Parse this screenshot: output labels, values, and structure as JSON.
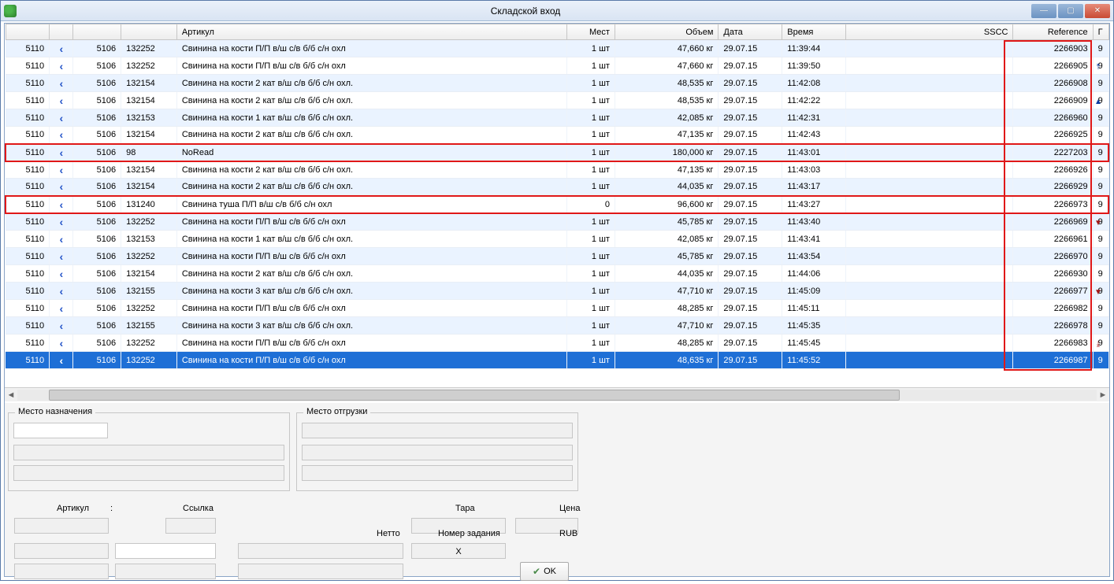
{
  "window": {
    "title": "Складской вход"
  },
  "columns": {
    "article": "Артикул",
    "mest": "Мест",
    "volume": "Объем",
    "date": "Дата",
    "time": "Время",
    "sscc": "SSCC",
    "reference": "Reference",
    "extra": "Г"
  },
  "rows": [
    {
      "c1": "5110",
      "c2": "5106",
      "c3": "132252",
      "desc": "Свинина на кости П/П в/ш с/в б/б с/н охл",
      "mest": "1 шт",
      "vol": "47,660 кг",
      "date": "29.07.15",
      "time": "11:39:44",
      "ref": "2266903",
      "e": "9",
      "hl": false,
      "sel": false
    },
    {
      "c1": "5110",
      "c2": "5106",
      "c3": "132252",
      "desc": "Свинина на кости П/П в/ш с/в б/б с/н охл",
      "mest": "1 шт",
      "vol": "47,660 кг",
      "date": "29.07.15",
      "time": "11:39:50",
      "ref": "2266905",
      "e": "9",
      "hl": false,
      "sel": false
    },
    {
      "c1": "5110",
      "c2": "5106",
      "c3": "132154",
      "desc": "Свинина на кости 2 кат в/ш с/в б/б с/н охл.",
      "mest": "1 шт",
      "vol": "48,535 кг",
      "date": "29.07.15",
      "time": "11:42:08",
      "ref": "2266908",
      "e": "9",
      "hl": false,
      "sel": false
    },
    {
      "c1": "5110",
      "c2": "5106",
      "c3": "132154",
      "desc": "Свинина на кости 2 кат в/ш с/в б/б с/н охл.",
      "mest": "1 шт",
      "vol": "48,535 кг",
      "date": "29.07.15",
      "time": "11:42:22",
      "ref": "2266909",
      "e": "9",
      "hl": false,
      "sel": false
    },
    {
      "c1": "5110",
      "c2": "5106",
      "c3": "132153",
      "desc": "Свинина на кости 1 кат в/ш с/в б/б с/н охл.",
      "mest": "1 шт",
      "vol": "42,085 кг",
      "date": "29.07.15",
      "time": "11:42:31",
      "ref": "2266960",
      "e": "9",
      "hl": false,
      "sel": false
    },
    {
      "c1": "5110",
      "c2": "5106",
      "c3": "132154",
      "desc": "Свинина на кости 2 кат в/ш с/в б/б с/н охл.",
      "mest": "1 шт",
      "vol": "47,135 кг",
      "date": "29.07.15",
      "time": "11:42:43",
      "ref": "2266925",
      "e": "9",
      "hl": false,
      "sel": false
    },
    {
      "c1": "5110",
      "c2": "5106",
      "c3": "98",
      "desc": "NoRead",
      "mest": "1 шт",
      "vol": "180,000 кг",
      "date": "29.07.15",
      "time": "11:43:01",
      "ref": "2227203",
      "e": "9",
      "hl": true,
      "sel": false
    },
    {
      "c1": "5110",
      "c2": "5106",
      "c3": "132154",
      "desc": "Свинина на кости 2 кат в/ш с/в б/б с/н охл.",
      "mest": "1 шт",
      "vol": "47,135 кг",
      "date": "29.07.15",
      "time": "11:43:03",
      "ref": "2266926",
      "e": "9",
      "hl": false,
      "sel": false
    },
    {
      "c1": "5110",
      "c2": "5106",
      "c3": "132154",
      "desc": "Свинина на кости 2 кат в/ш с/в б/б с/н охл.",
      "mest": "1 шт",
      "vol": "44,035 кг",
      "date": "29.07.15",
      "time": "11:43:17",
      "ref": "2266929",
      "e": "9",
      "hl": false,
      "sel": false
    },
    {
      "c1": "5110",
      "c2": "5106",
      "c3": "131240",
      "desc": "Свинина туша П/П в/ш с/в б/б с/н охл",
      "mest": "0",
      "vol": "96,600 кг",
      "date": "29.07.15",
      "time": "11:43:27",
      "ref": "2266973",
      "e": "9",
      "hl": true,
      "sel": false
    },
    {
      "c1": "5110",
      "c2": "5106",
      "c3": "132252",
      "desc": "Свинина на кости П/П в/ш с/в б/б с/н охл",
      "mest": "1 шт",
      "vol": "45,785 кг",
      "date": "29.07.15",
      "time": "11:43:40",
      "ref": "2266969",
      "e": "9",
      "hl": false,
      "sel": false
    },
    {
      "c1": "5110",
      "c2": "5106",
      "c3": "132153",
      "desc": "Свинина на кости 1 кат в/ш с/в б/б с/н охл.",
      "mest": "1 шт",
      "vol": "42,085 кг",
      "date": "29.07.15",
      "time": "11:43:41",
      "ref": "2266961",
      "e": "9",
      "hl": false,
      "sel": false
    },
    {
      "c1": "5110",
      "c2": "5106",
      "c3": "132252",
      "desc": "Свинина на кости П/П в/ш с/в б/б с/н охл",
      "mest": "1 шт",
      "vol": "45,785 кг",
      "date": "29.07.15",
      "time": "11:43:54",
      "ref": "2266970",
      "e": "9",
      "hl": false,
      "sel": false
    },
    {
      "c1": "5110",
      "c2": "5106",
      "c3": "132154",
      "desc": "Свинина на кости 2 кат в/ш с/в б/б с/н охл.",
      "mest": "1 шт",
      "vol": "44,035 кг",
      "date": "29.07.15",
      "time": "11:44:06",
      "ref": "2266930",
      "e": "9",
      "hl": false,
      "sel": false
    },
    {
      "c1": "5110",
      "c2": "5106",
      "c3": "132155",
      "desc": "Свинина на кости 3 кат в/ш с/в б/б с/н охл.",
      "mest": "1 шт",
      "vol": "47,710 кг",
      "date": "29.07.15",
      "time": "11:45:09",
      "ref": "2266977",
      "e": "9",
      "hl": false,
      "sel": false
    },
    {
      "c1": "5110",
      "c2": "5106",
      "c3": "132252",
      "desc": "Свинина на кости П/П в/ш с/в б/б с/н охл",
      "mest": "1 шт",
      "vol": "48,285 кг",
      "date": "29.07.15",
      "time": "11:45:11",
      "ref": "2266982",
      "e": "9",
      "hl": false,
      "sel": false
    },
    {
      "c1": "5110",
      "c2": "5106",
      "c3": "132155",
      "desc": "Свинина на кости 3 кат в/ш с/в б/б с/н охл.",
      "mest": "1 шт",
      "vol": "47,710 кг",
      "date": "29.07.15",
      "time": "11:45:35",
      "ref": "2266978",
      "e": "9",
      "hl": false,
      "sel": false
    },
    {
      "c1": "5110",
      "c2": "5106",
      "c3": "132252",
      "desc": "Свинина на кости П/П в/ш с/в б/б с/н охл",
      "mest": "1 шт",
      "vol": "48,285 кг",
      "date": "29.07.15",
      "time": "11:45:45",
      "ref": "2266983",
      "e": "9",
      "hl": false,
      "sel": false
    },
    {
      "c1": "5110",
      "c2": "5106",
      "c3": "132252",
      "desc": "Свинина на кости П/П в/ш с/в б/б с/н охл",
      "mest": "1 шт",
      "vol": "48,635 кг",
      "date": "29.07.15",
      "time": "11:45:52",
      "ref": "2266987",
      "e": "9",
      "hl": false,
      "sel": true
    }
  ],
  "panels": {
    "dest": "Место назначения",
    "ship": "Место отгрузки",
    "article": "Артикул",
    "colon": ":",
    "link": "Ссылка",
    "netto": "Нетто",
    "tara": "Тара",
    "price": "Цена",
    "task": "Номер задания",
    "currency": "RUB",
    "x": "X",
    "ok": "OK"
  },
  "nav_glyphs": {
    "first": "⤒",
    "pageup": "▲",
    "up": "▲",
    "down": "▼",
    "pagedown": "▼",
    "last": "⤓"
  }
}
